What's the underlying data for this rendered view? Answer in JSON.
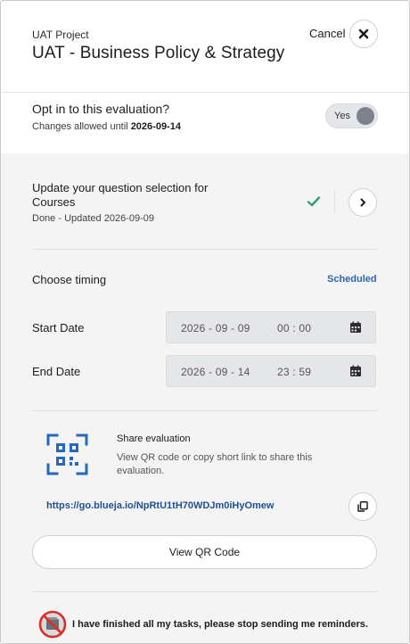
{
  "header": {
    "project": "UAT Project",
    "title": "UAT - Business Policy & Strategy",
    "cancel_label": "Cancel",
    "close_icon": "close-icon"
  },
  "optin": {
    "question": "Opt in to this evaluation?",
    "changes_prefix": "Changes allowed until ",
    "changes_date": "2026-09-14",
    "toggle_label": "Yes",
    "toggle_on": true
  },
  "question_selection": {
    "title": "Update your question selection for Courses",
    "status": "Done - Updated 2026-09-09",
    "check_icon": "checkmark-icon",
    "check_color": "#2e9b7f",
    "next_icon": "chevron-right-icon"
  },
  "timing": {
    "label": "Choose timing",
    "value": "Scheduled",
    "start": {
      "label": "Start Date",
      "date": "2026 - 09 - 09",
      "time": "00 : 00",
      "icon": "calendar-icon"
    },
    "end": {
      "label": "End Date",
      "date": "2026 - 09 - 14",
      "time": "23 : 59",
      "icon": "calendar-icon"
    }
  },
  "share": {
    "title": "Share evaluation",
    "description": "View QR code or copy short link to share this evaluation.",
    "link": "https://go.blueja.io/NpRtU1tH70WDJm0iHyOmew",
    "qr_icon": "qr-code-icon",
    "copy_icon": "copy-icon",
    "qr_button": "View QR Code"
  },
  "reminder": {
    "text": "I have finished all my tasks, please stop sending me reminders.",
    "icon": "no-notification-icon"
  },
  "colors": {
    "accent": "#2b66ad",
    "link": "#1f4f91",
    "qr_blue": "#2767bd",
    "success": "#2e9b7f",
    "danger": "#d93025"
  }
}
